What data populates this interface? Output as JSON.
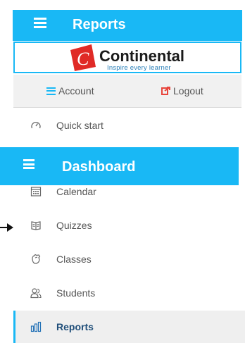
{
  "header": {
    "title": "Reports"
  },
  "logo": {
    "name": "Continental",
    "tagline": "Inspire every learner"
  },
  "account_row": {
    "account_label": "Account",
    "logout_label": "Logout"
  },
  "menu": {
    "quick_start": "Quick start",
    "calendar": "Calendar",
    "quizzes": "Quizzes",
    "classes": "Classes",
    "students": "Students",
    "reports": "Reports"
  },
  "dashboard": {
    "title": "Dashboard"
  },
  "colors": {
    "accent": "#19b8f5",
    "logout_icon": "#e8453c",
    "logo_red": "#e02a26",
    "tagline": "#2a7fb8",
    "active_text": "#1f4e79"
  },
  "icons": {
    "header_menu": "hamburger-icon",
    "account": "hamburger-icon",
    "logout": "logout-icon",
    "quick_start": "gauge-icon",
    "calendar": "calendar-icon",
    "quizzes": "book-icon",
    "classes": "hand-icon",
    "students": "users-icon",
    "reports": "bar-chart-icon",
    "annotation": "arrow-right-icon"
  }
}
